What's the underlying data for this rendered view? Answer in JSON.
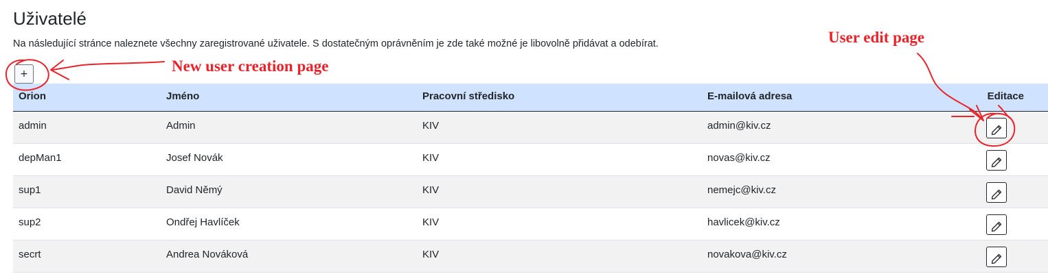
{
  "page": {
    "title": "Uživatelé",
    "description": "Na následující stránce naleznete všechny zaregistrované uživatele. S dostatečným oprávněním je zde také možné je libovolně přidávat a odebírat."
  },
  "toolbar": {
    "add_label": "+"
  },
  "table": {
    "headers": [
      "Orion",
      "Jméno",
      "Pracovní středisko",
      "E-mailová adresa",
      "Editace"
    ],
    "rows": [
      {
        "orion": "admin",
        "name": "Admin",
        "department": "KIV",
        "email": "admin@kiv.cz"
      },
      {
        "orion": "depMan1",
        "name": "Josef Novák",
        "department": "KIV",
        "email": "novas@kiv.cz"
      },
      {
        "orion": "sup1",
        "name": "David Němý",
        "department": "KIV",
        "email": "nemejc@kiv.cz"
      },
      {
        "orion": "sup2",
        "name": "Ondřej Havlíček",
        "department": "KIV",
        "email": "havlicek@kiv.cz"
      },
      {
        "orion": "secrt",
        "name": "Andrea Nováková",
        "department": "KIV",
        "email": "novakova@kiv.cz"
      }
    ],
    "edit_icon": "pencil-icon"
  },
  "annotations": {
    "new_user": "New user creation page",
    "edit_user": "User edit page",
    "color": "#e8232a"
  },
  "colors": {
    "header_background": "#cfe2ff",
    "stripe": "#f2f2f2"
  }
}
